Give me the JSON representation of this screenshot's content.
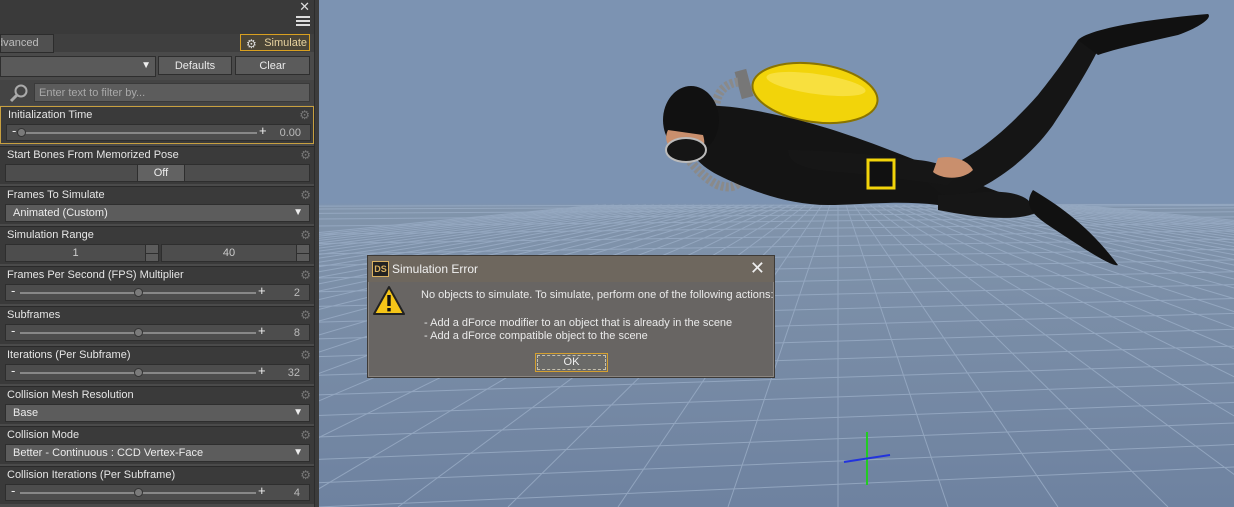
{
  "panel": {
    "tab_advanced": "dvanced",
    "tab_simulate": "Simulate",
    "defaults_label": "Defaults",
    "clear_label": "Clear",
    "filter_placeholder": "Enter text to filter by...",
    "properties": [
      {
        "label": "Initialization Time",
        "kind": "slider",
        "value": "0.00",
        "level": 0.0
      },
      {
        "label": "Start Bones From Memorized Pose",
        "kind": "toggle",
        "value": "Off"
      },
      {
        "label": "Frames To Simulate",
        "kind": "dropdown",
        "value": "Animated (Custom)"
      },
      {
        "label": "Simulation Range",
        "kind": "range",
        "start": "1",
        "end": "40"
      },
      {
        "label": "Frames Per Second (FPS) Multiplier",
        "kind": "slider",
        "value": "2",
        "level": 0.5
      },
      {
        "label": "Subframes",
        "kind": "slider",
        "value": "8",
        "level": 0.5
      },
      {
        "label": "Iterations (Per Subframe)",
        "kind": "slider",
        "value": "32",
        "level": 0.5
      },
      {
        "label": "Collision Mesh Resolution",
        "kind": "dropdown",
        "value": "Base"
      },
      {
        "label": "Collision Mode",
        "kind": "dropdown",
        "value": "Better - Continuous : CCD Vertex-Face"
      },
      {
        "label": "Collision Iterations (Per Subframe)",
        "kind": "slider",
        "value": "4",
        "level": 0.5
      }
    ]
  },
  "dialog": {
    "icon_label": "DS",
    "title": "Simulation Error",
    "message": "No objects to simulate. To simulate, perform one of the following actions:",
    "bullet_1": "- Add a dForce modifier to an object that is already in the scene",
    "bullet_2": "- Add a dForce compatible object to the scene",
    "ok_label": "OK"
  },
  "colors": {
    "accent": "#d9a020",
    "tank": "#f2d40a",
    "panel_bg": "#3a3a3a",
    "viewport_bg": "#7c93b2",
    "axis_green": "#22cc22",
    "axis_blue": "#2233dd"
  }
}
